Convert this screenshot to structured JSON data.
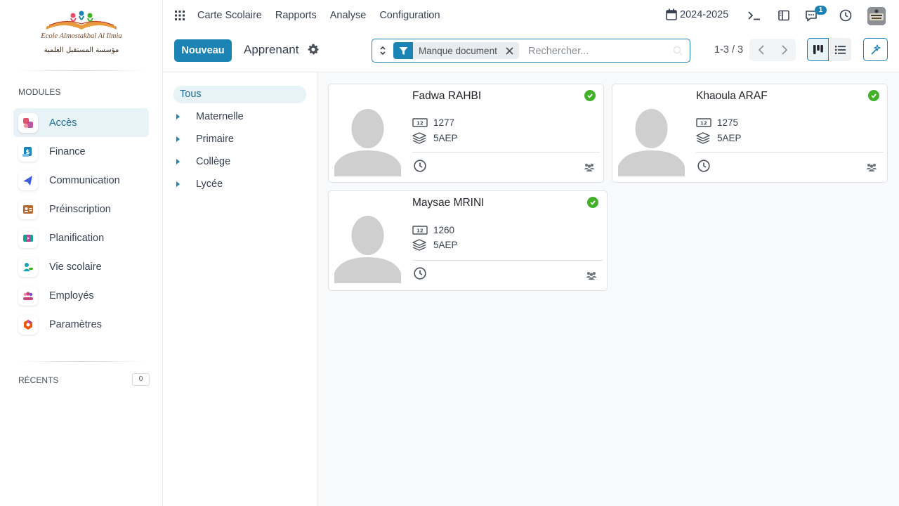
{
  "logo": {
    "text_latin": "Ecole Almostakbal Al Ilmia",
    "text_arabic": "مؤسسة المستقبل العلمية"
  },
  "sidebar": {
    "modules_title": "MODULES",
    "items": [
      {
        "label": "Accès",
        "icon": "access-icon",
        "color": "#e2516b"
      },
      {
        "label": "Finance",
        "icon": "finance-icon",
        "color": "#1b84b5"
      },
      {
        "label": "Communication",
        "icon": "communication-icon",
        "color": "#3b5bdb"
      },
      {
        "label": "Préinscription",
        "icon": "preregistration-icon",
        "color": "#b6652b"
      },
      {
        "label": "Planification",
        "icon": "planning-icon",
        "color": "#12a594"
      },
      {
        "label": "Vie scolaire",
        "icon": "school-life-icon",
        "color": "#17a2b8"
      },
      {
        "label": "Employés",
        "icon": "employees-icon",
        "color": "#c2477f"
      },
      {
        "label": "Paramètres",
        "icon": "settings-icon",
        "color": "#e8590c"
      }
    ],
    "recents_title": "RÉCENTS",
    "recents_count": "0"
  },
  "topbar": {
    "menu": [
      "Carte Scolaire",
      "Rapports",
      "Analyse",
      "Configuration"
    ],
    "year": "2024-2025",
    "messages_badge": "1"
  },
  "control": {
    "new_button": "Nouveau",
    "title": "Apprenant",
    "facet": "Manque document",
    "search_placeholder": "Rechercher...",
    "pager": "1-3 / 3"
  },
  "categories": {
    "all": "Tous",
    "items": [
      "Maternelle",
      "Primaire",
      "Collège",
      "Lycée"
    ]
  },
  "cards": [
    {
      "name": "Fadwa RAHBI",
      "number": "1277",
      "class": "5AEP"
    },
    {
      "name": "Khaoula ARAF",
      "number": "1275",
      "class": "5AEP"
    },
    {
      "name": "Maysae MRINI",
      "number": "1260",
      "class": "5AEP"
    }
  ],
  "colors": {
    "primary": "#1b84b5",
    "status_ok": "#43b02a"
  }
}
